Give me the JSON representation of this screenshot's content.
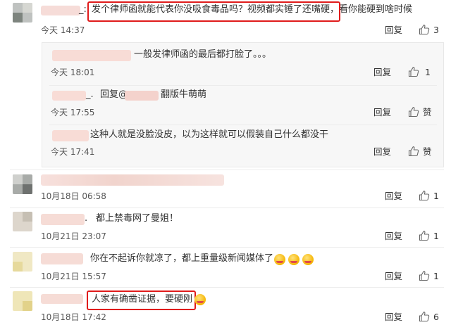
{
  "comment1": {
    "name_suffix": "_:",
    "text": "发个律师函就能代表你没吸食毒品吗？视频都实锤了还嘴硬，看你能硬到啥时候",
    "time": "今天 14:37",
    "reply_label": "回复",
    "like_count": "3"
  },
  "replies": [
    {
      "text": "一般发律师函的最后都打脸了。。。",
      "time": "今天 18:01",
      "reply_label": "回复",
      "like_count": "1"
    },
    {
      "name_suffix": "_.",
      "reply_to_label": "回复@",
      "text": "翻版牛萌萌",
      "time": "今天 17:55",
      "reply_label": "回复",
      "like_count": "赞"
    },
    {
      "text": "这种人就是没脸没皮，以为这样就可以假装自己什么都没干",
      "time": "今天 17:41",
      "reply_label": "回复",
      "like_count": "赞"
    }
  ],
  "comments": [
    {
      "text": "",
      "time": "10月18日 06:58",
      "reply_label": "回复",
      "like_count": "1"
    },
    {
      "name_suffix": ".",
      "text": "都上禁毒网了曼姐！",
      "time": "10月21日 23:07",
      "reply_label": "回复",
      "like_count": "1"
    },
    {
      "text": "你在不起诉你就凉了，都上重量级新闻媒体了",
      "time": "10月21日 15:57",
      "reply_label": "回复",
      "like_count": "1"
    },
    {
      "text": "人家有确凿证据，要硬刚",
      "time": "10月18日 17:42",
      "reply_label": "回复",
      "like_count": "6"
    }
  ],
  "icons": {
    "like": "thumbs-up-icon",
    "emoji": "grinning-face-emoji"
  },
  "colors": {
    "highlight_border": "#e01b1b",
    "reply_panel_bg": "#f7f7f7",
    "mention": "#eb7350"
  }
}
